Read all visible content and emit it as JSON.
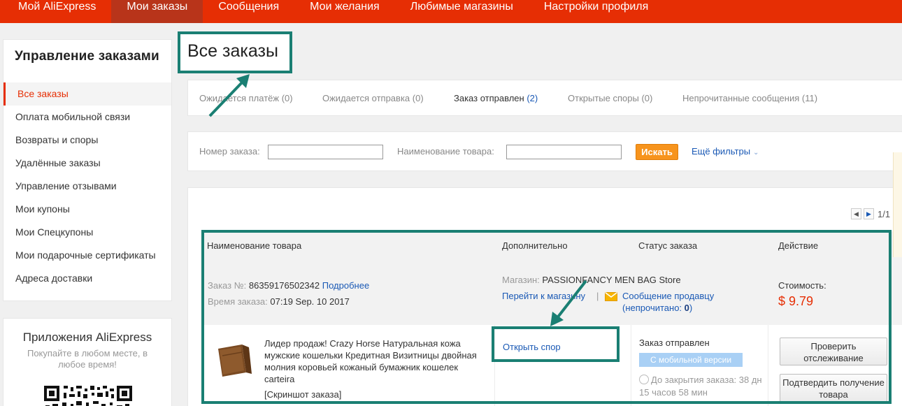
{
  "nav": {
    "items": [
      "Мой AliExpress",
      "Мои заказы",
      "Сообщения",
      "Мои желания",
      "Любимые магазины",
      "Настройки профиля"
    ],
    "active_index": 1
  },
  "sidebar": {
    "title": "Управление заказами",
    "items": [
      "Все заказы",
      "Оплата мобильной связи",
      "Возвраты и споры",
      "Удалённые заказы",
      "Управление отзывами",
      "Мои купоны",
      "Мои Спецкупоны",
      "Мои подарочные сертификаты",
      "Адреса доставки"
    ],
    "active_index": 0
  },
  "apps": {
    "title": "Приложения AliExpress",
    "subtitle": "Покупайте в любом месте, в любое время!"
  },
  "page_title": "Все заказы",
  "tabs": [
    {
      "label": "Ожидается платёж",
      "count": "(0)"
    },
    {
      "label": "Ожидается отправка",
      "count": "(0)"
    },
    {
      "label": "Заказ отправлен",
      "count": "(2)"
    },
    {
      "label": "Открытые споры",
      "count": "(0)"
    },
    {
      "label": "Непрочитанные сообщения",
      "count": "(11)"
    }
  ],
  "filters": {
    "order_number_label": "Номер заказа:",
    "order_number_value": "",
    "product_name_label": "Наименование товара:",
    "product_name_value": "",
    "search_button": "Искать",
    "more_filters": "Ещё фильтры"
  },
  "pager": {
    "text": "1/1"
  },
  "table": {
    "headers": [
      "Наименование товара",
      "Дополнительно",
      "Статус заказа",
      "Действие"
    ]
  },
  "order": {
    "number_label": "Заказ №:",
    "number": "86359176502342",
    "details_link": "Подробнее",
    "time_label": "Время заказа:",
    "time": "07:19 Sep. 10 2017",
    "store_label": "Магазин:",
    "store_name": "PASSIONFANCY MEN BAG Store",
    "go_to_store": "Перейти к магазину",
    "message_seller": "Сообщение продавцу",
    "unread_prefix": "(непрочитано:",
    "unread_count": "0",
    "unread_suffix": ")",
    "cost_label": "Стоимость:",
    "cost": "$ 9.79",
    "product_title": "Лидер продаж! Crazy Horse Натуральная кожа мужские кошельки Кредитная Визитницы двойная молния коровьей кожаный бумажник кошелек carteira",
    "product_note": "[Скриншот заказа]",
    "open_dispute": "Открыть спор",
    "status": "Заказ отправлен",
    "mobile_badge": "С мобильной версии",
    "countdown": "До закрытия заказа: 38 дн 15 часов 58 мин",
    "track_button": "Проверить отслеживание",
    "confirm_button": "Подтвердить получение товара"
  },
  "colors": {
    "brand_red": "#e62e04",
    "annotation_teal": "#1a7f73",
    "link_blue": "#1a59b5",
    "search_orange": "#f7941d"
  }
}
